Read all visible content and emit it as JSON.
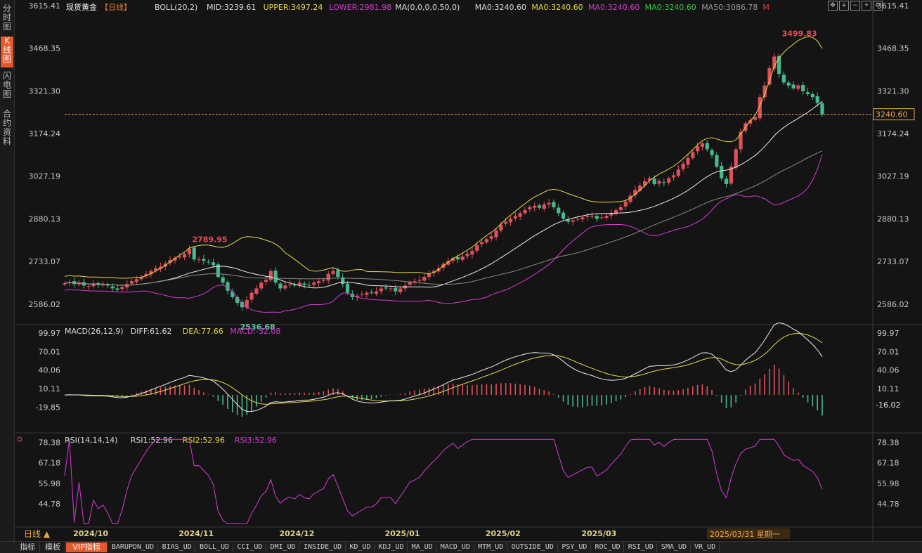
{
  "instrument": {
    "name": "现货黄金",
    "period": "【日线】"
  },
  "sidebar": [
    {
      "label": "分时图",
      "active": false
    },
    {
      "label": "K线图",
      "active": true
    },
    {
      "label": "闪电图",
      "active": false
    },
    {
      "label": "合约资料",
      "active": false
    }
  ],
  "main_legend": [
    {
      "text": "BOLL(20,2)",
      "color": "#dcdcdc"
    },
    {
      "text": "MID:3239.61",
      "color": "#dcdcdc"
    },
    {
      "text": "UPPER:3497.24",
      "color": "#e6d94a"
    },
    {
      "text": "LOWER:2981.98",
      "color": "#d63bd6"
    },
    {
      "text": "MA(0,0,0,0,50,0)",
      "color": "#dcdcdc"
    },
    {
      "text": "MA0:3240.60",
      "color": "#dcdcdc"
    },
    {
      "text": "MA0:3240.60",
      "color": "#e6d94a"
    },
    {
      "text": "MA0:3240.60",
      "color": "#d63bd6"
    },
    {
      "text": "MA0:3240.60",
      "color": "#3cc84a"
    },
    {
      "text": "MA50:3086.78",
      "color": "#9a9a9a"
    },
    {
      "text": "M",
      "color": "#e23b3b"
    }
  ],
  "macd_legend": [
    {
      "text": "MACD(26,12,9)",
      "color": "#dcdcdc"
    },
    {
      "text": "DIFF:61.62",
      "color": "#dcdcdc"
    },
    {
      "text": "DEA:77.66",
      "color": "#e6d94a"
    },
    {
      "text": "MACD:-32.08",
      "color": "#d63bd6"
    }
  ],
  "rsi_legend": [
    {
      "text": "RSI(14,14,14)",
      "color": "#dcdcdc"
    },
    {
      "text": "RSI1:52.96",
      "color": "#dcdcdc"
    },
    {
      "text": "RSI2:52.96",
      "color": "#e6d94a"
    },
    {
      "text": "RSI3:52.96",
      "color": "#d63bd6"
    }
  ],
  "colors": {
    "up": "#e0505a",
    "down": "#47b98a",
    "upper": "#e6d94a",
    "lower": "#d63bd6",
    "mid": "#eeeeee",
    "ma50": "#8a8a8a",
    "rsi": "#d63bd6",
    "current": "#e8a64a"
  },
  "chart_data": [
    {
      "type": "candlestick",
      "title": "现货黄金【日线】",
      "ylim": [
        2520,
        3615.41
      ],
      "yticks": [
        "3615.41",
        "3468.35",
        "3321.30",
        "3174.24",
        "3027.19",
        "2880.13",
        "2733.07",
        "2586.02"
      ],
      "ytick_values": [
        3615.41,
        3468.35,
        3321.3,
        3174.24,
        3027.19,
        2880.13,
        2733.07,
        2586.02
      ],
      "x_labels": [
        {
          "label": "2024/10",
          "index": 5
        },
        {
          "label": "2024/11",
          "index": 27
        },
        {
          "label": "2024/12",
          "index": 48
        },
        {
          "label": "2025/01",
          "index": 70
        },
        {
          "label": "2025/02",
          "index": 91
        },
        {
          "label": "2025/03",
          "index": 111
        }
      ],
      "cursor_label": "2025/03/31 星期一",
      "current_price": 3240.6,
      "current_price_label": "3240.60",
      "annotations": [
        {
          "text": "2789.95",
          "index": 26,
          "value": 2789.95
        },
        {
          "text": "2536.68",
          "index": 36,
          "value": 2536.68
        },
        {
          "text": "3499.83",
          "index": 149,
          "value": 3499.83
        }
      ],
      "closes": [
        2658,
        2662,
        2655,
        2660,
        2650,
        2648,
        2655,
        2652,
        2653,
        2650,
        2640,
        2635,
        2645,
        2655,
        2665,
        2672,
        2680,
        2690,
        2700,
        2710,
        2715,
        2725,
        2738,
        2745,
        2750,
        2758,
        2778,
        2740,
        2740,
        2735,
        2730,
        2720,
        2680,
        2660,
        2632,
        2610,
        2590,
        2575,
        2600,
        2625,
        2640,
        2660,
        2670,
        2700,
        2660,
        2640,
        2650,
        2655,
        2650,
        2660,
        2652,
        2650,
        2660,
        2665,
        2670,
        2690,
        2700,
        2680,
        2655,
        2625,
        2610,
        2615,
        2620,
        2625,
        2625,
        2630,
        2640,
        2640,
        2640,
        2630,
        2640,
        2650,
        2662,
        2665,
        2670,
        2680,
        2690,
        2700,
        2710,
        2725,
        2735,
        2745,
        2740,
        2750,
        2760,
        2770,
        2790,
        2800,
        2810,
        2820,
        2840,
        2860,
        2870,
        2880,
        2890,
        2900,
        2910,
        2920,
        2925,
        2918,
        2930,
        2935,
        2920,
        2900,
        2880,
        2870,
        2875,
        2880,
        2885,
        2890,
        2890,
        2880,
        2885,
        2890,
        2900,
        2910,
        2920,
        2940,
        2960,
        2980,
        2995,
        3010,
        3020,
        3000,
        3010,
        3005,
        3020,
        3030,
        3050,
        3070,
        3090,
        3110,
        3130,
        3140,
        3120,
        3100,
        3060,
        3020,
        3000,
        3060,
        3120,
        3180,
        3210,
        3220,
        3230,
        3300,
        3340,
        3400,
        3440,
        3380,
        3350,
        3340,
        3330,
        3340,
        3320,
        3310,
        3300,
        3280,
        3240.6
      ],
      "boll_upper_range": [
        2981.98,
        3497.24
      ],
      "boll_mid_last": 3239.61,
      "boll_lower_last": 2981.98,
      "ma50_last": 3086.78
    },
    {
      "type": "macd",
      "ylim": [
        -60,
        110
      ],
      "yticks": [
        "99.97",
        "70.01",
        "40.06",
        "10.11",
        "-19.85"
      ],
      "ytick_values": [
        99.97,
        70.01,
        40.06,
        10.11,
        -19.85
      ],
      "diff_last": 61.62,
      "dea_last": 77.66,
      "macd_last": -32.08,
      "current_label": "-16.02",
      "current_value": -16.02
    },
    {
      "type": "line",
      "name": "RSI",
      "ylim": [
        33,
        82
      ],
      "yticks": [
        "78.38",
        "67.18",
        "55.98",
        "44.78"
      ],
      "ytick_values": [
        78.38,
        67.18,
        55.98,
        44.78
      ],
      "rsi_last": 52.96
    }
  ],
  "bottom_tabs": [
    "指标",
    "模板",
    "VIP指标",
    "BARUPDN_UD",
    "BIAS_UD",
    "BOLL_UD",
    "CCI_UD",
    "DMI_UD",
    "INSIDE_UD",
    "KD_UD",
    "KDJ_UD",
    "MA_UD",
    "MACD_UD",
    "MTM_UD",
    "OUTSIDE_UD",
    "PSY_UD",
    "ROC_UD",
    "RSI_UD",
    "SMA_UD",
    "VR_UD"
  ],
  "period_selector": "日线 ▲",
  "toolbar_icons": [
    "fullscreen-icon",
    "zoom-in-icon",
    "zoom-out-icon",
    "crosshair-icon",
    "settings-icon"
  ]
}
